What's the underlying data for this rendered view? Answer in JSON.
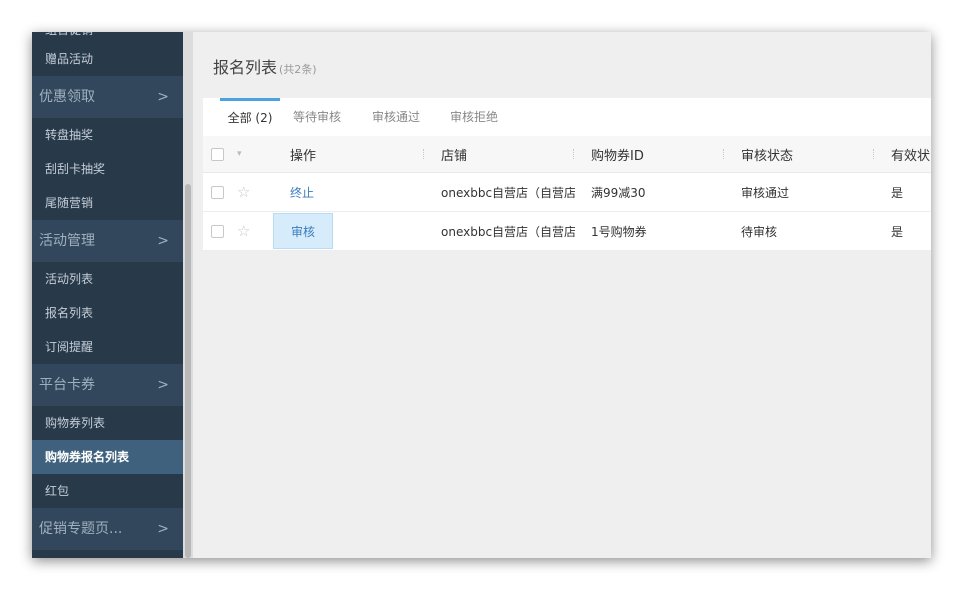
{
  "sidebar": {
    "items": [
      {
        "type": "item",
        "label": "组合促销",
        "cut": true
      },
      {
        "type": "item",
        "label": "赠品活动"
      },
      {
        "type": "head",
        "label": "优惠领取"
      },
      {
        "type": "item",
        "label": "转盘抽奖"
      },
      {
        "type": "item",
        "label": "刮刮卡抽奖"
      },
      {
        "type": "item",
        "label": "尾随营销"
      },
      {
        "type": "head",
        "label": "活动管理"
      },
      {
        "type": "item",
        "label": "活动列表"
      },
      {
        "type": "item",
        "label": "报名列表"
      },
      {
        "type": "item",
        "label": "订阅提醒"
      },
      {
        "type": "head",
        "label": "平台卡券"
      },
      {
        "type": "item",
        "label": "购物券列表"
      },
      {
        "type": "item",
        "label": "购物券报名列表",
        "active": true
      },
      {
        "type": "item",
        "label": "红包"
      },
      {
        "type": "head",
        "label": "促销专题页..."
      }
    ],
    "chevron": ">"
  },
  "page": {
    "title": "报名列表",
    "count": "(共2条)"
  },
  "tabs": [
    {
      "label": "全部 (2)",
      "active": true
    },
    {
      "label": "等待审核"
    },
    {
      "label": "审核通过"
    },
    {
      "label": "审核拒绝"
    }
  ],
  "table": {
    "columns": [
      "操作",
      "店铺",
      "购物券ID",
      "审核状态",
      "有效状"
    ],
    "rows": [
      {
        "action": "终止",
        "store": "onexbbc自营店（自营店铺）",
        "coupon": "满99减30",
        "status": "审核通过",
        "valid": "是"
      },
      {
        "action": "审核",
        "store": "onexbbc自营店（自营店铺）",
        "coupon": "1号购物券",
        "status": "待审核",
        "valid": "是"
      }
    ]
  },
  "icons": {
    "star": "☆",
    "caret": "▾"
  },
  "colors": {
    "sidebar_bg": "#28394a",
    "accent": "#4aa3df",
    "link": "#3a7dbd"
  }
}
